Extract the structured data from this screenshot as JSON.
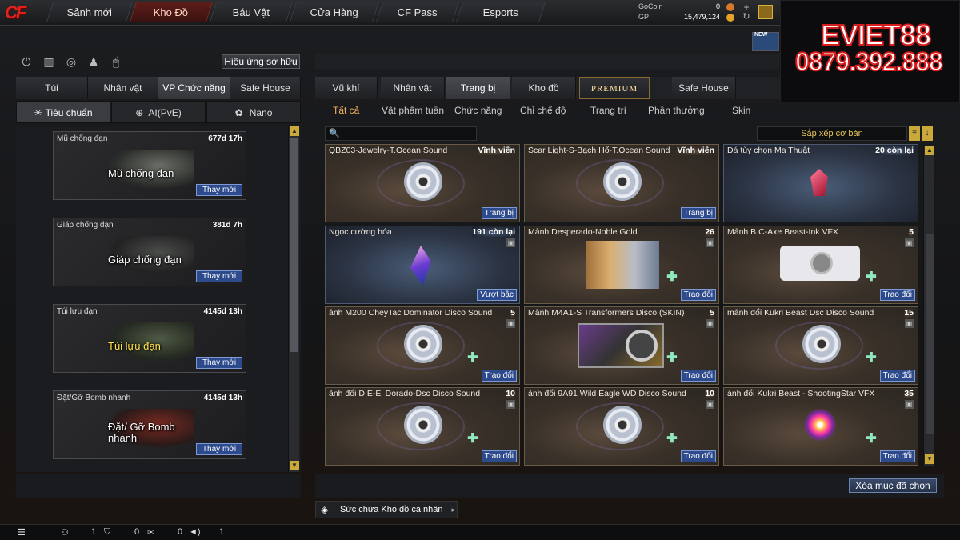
{
  "nav": {
    "tabs": [
      "Sảnh mới",
      "Kho Đồ",
      "Báu Vật",
      "Cửa Hàng",
      "CF Pass",
      "Esports"
    ]
  },
  "currency": {
    "gocoin_label": "GoCoin",
    "gocoin_value": "0",
    "gp_label": "GP",
    "gp_value": "15,479,124"
  },
  "promo": {
    "line1": "EVIET88",
    "line2": "0879.392.888",
    "badge": "NEW"
  },
  "left": {
    "effect_button": "Hiệu ứng sở hữu",
    "tabs": [
      "Túi",
      "Nhân vật",
      "VP Chức năng",
      "Safe House"
    ],
    "subtabs": [
      "Tiêu chuẩn",
      "AI(PvE)",
      "Nano"
    ],
    "items": [
      {
        "name": "Mũ chống đạn",
        "time": "677d 17h",
        "caption": "Mũ chống đạn",
        "action": "Thay mới"
      },
      {
        "name": "Giáp chống đạn",
        "time": "381d 7h",
        "caption": "Giáp chống đạn",
        "action": "Thay mới"
      },
      {
        "name": "Túi lựu đạn",
        "time": "4145d 13h",
        "caption": "Túi lựu đạn",
        "action": "Thay mới"
      },
      {
        "name": "Đặt/Gỡ Bomb nhanh",
        "time": "4145d 13h",
        "caption": "Đặt/ Gỡ Bomb nhanh",
        "action": "Thay mới"
      }
    ]
  },
  "right": {
    "tabs": [
      "Vũ khí",
      "Nhân vật",
      "Trang bị",
      "Kho đồ",
      "PREMIUM",
      "Safe House"
    ],
    "filters": [
      "Tất cả",
      "Vật phẩm tuần",
      "Chức năng",
      "Chỉ chế độ",
      "Trang trí",
      "Phần thưởng",
      "Skin"
    ],
    "sort_label": "Sắp xếp cơ bản",
    "items": [
      {
        "name": "QBZ03-Jewelry-T.Ocean Sound",
        "qty": "Vĩnh viễn",
        "action": "Trang bị"
      },
      {
        "name": "Scar Light-S-Bạch Hổ-T.Ocean Sound",
        "qty": "Vĩnh viễn",
        "action": "Trang bị"
      },
      {
        "name": "Đá tùy chọn Ma Thuật",
        "qty": "20 còn lại",
        "action": ""
      },
      {
        "name": "Ngọc cường hóa",
        "qty": "191 còn lại",
        "action": "Vượt bậc"
      },
      {
        "name": "Mảnh Desperado-Noble Gold",
        "qty": "26",
        "action": "Trao đổi"
      },
      {
        "name": "Mảnh B.C-Axe Beast-Ink VFX",
        "qty": "5",
        "action": "Trao đổi"
      },
      {
        "name": "ảnh M200 CheyTac Dominator Disco Sound",
        "qty": "5",
        "action": "Trao đổi"
      },
      {
        "name": "Mảnh M4A1-S Transformers Disco (SKIN)",
        "qty": "5",
        "action": "Trao đổi"
      },
      {
        "name": "mảnh đổi Kukri Beast Dsc Disco Sound",
        "qty": "15",
        "action": "Trao đổi"
      },
      {
        "name": "ảnh đổi D.E-El Dorado-Dsc Disco Sound",
        "qty": "10",
        "action": "Trao đổi"
      },
      {
        "name": "ảnh đổi 9A91 Wild Eagle WD Disco Sound",
        "qty": "10",
        "action": "Trao đổi"
      },
      {
        "name": "ảnh đổi Kukri Beast - ShootingStar VFX",
        "qty": "35",
        "action": "Trao đổi"
      }
    ],
    "delete_selected": "Xóa mục đã chọn",
    "capacity": "Sức chứa Kho đồ cá nhân"
  },
  "status": {
    "v1": "1",
    "v2": "0",
    "v3": "0",
    "v4": "1"
  }
}
